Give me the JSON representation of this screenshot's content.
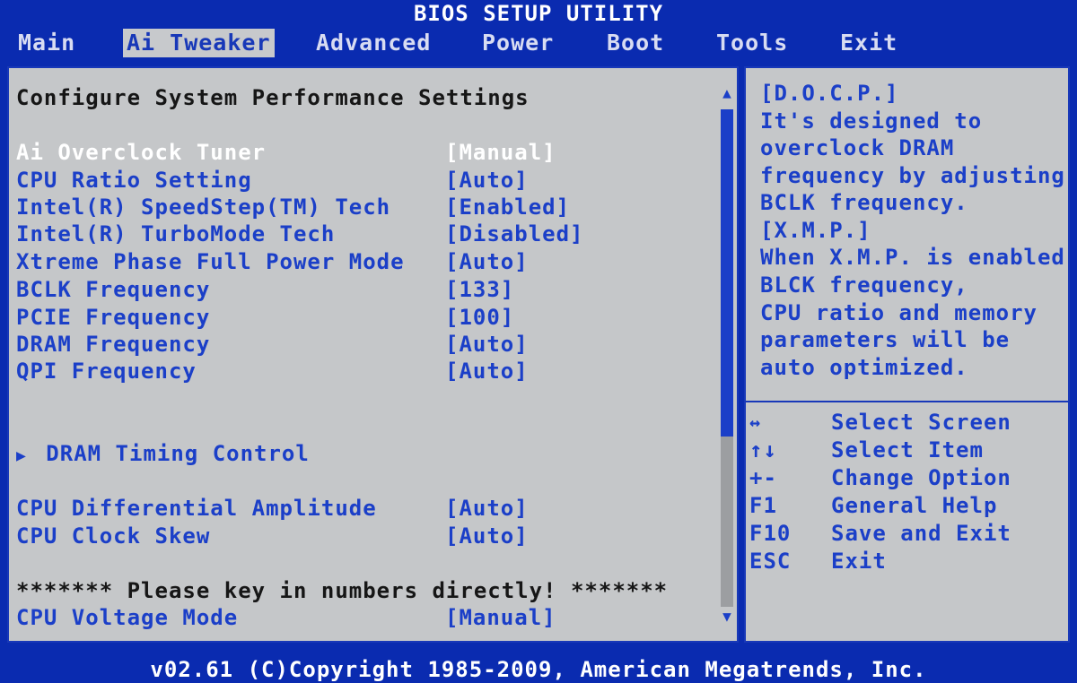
{
  "title": "BIOS SETUP UTILITY",
  "menu": {
    "main": "Main",
    "ai_tweaker": "Ai Tweaker",
    "advanced": "Advanced",
    "power": "Power",
    "boot": "Boot",
    "tools": "Tools",
    "exit": "Exit"
  },
  "section_title": "Configure System Performance Settings",
  "settings": [
    {
      "label": "Ai Overclock Tuner",
      "value": "[Manual]"
    },
    {
      "label": "CPU Ratio Setting",
      "value": "[Auto]"
    },
    {
      "label": "Intel(R) SpeedStep(TM) Tech",
      "value": "[Enabled]"
    },
    {
      "label": "Intel(R) TurboMode Tech",
      "value": "[Disabled]"
    },
    {
      "label": "Xtreme Phase Full Power Mode",
      "value": "[Auto]"
    },
    {
      "label": "BCLK Frequency",
      "value": "[133]"
    },
    {
      "label": "PCIE Frequency",
      "value": "[100]"
    },
    {
      "label": "DRAM Frequency",
      "value": "[Auto]"
    },
    {
      "label": "QPI Frequency",
      "value": "[Auto]"
    }
  ],
  "submenu": {
    "arrow": "▶",
    "label": "DRAM Timing Control"
  },
  "settings2": [
    {
      "label": "CPU Differential Amplitude",
      "value": "[Auto]"
    },
    {
      "label": "CPU Clock Skew",
      "value": "[Auto]"
    }
  ],
  "notice": "******* Please key in numbers directly! *******",
  "voltage": {
    "label": "CPU Voltage Mode",
    "value": "[Manual]"
  },
  "help_text": [
    "[D.O.C.P.]",
    "It's designed to",
    "overclock DRAM",
    "frequency by adjusting",
    "BCLK frequency.",
    "[X.M.P.]",
    "When X.M.P. is enabled",
    "BLCK frequency,",
    "CPU ratio and memory",
    "parameters will be",
    "auto optimized."
  ],
  "keys": [
    {
      "key": "↔",
      "desc": "Select Screen"
    },
    {
      "key": "↑↓",
      "desc": "Select Item"
    },
    {
      "key": "+-",
      "desc": "Change Option"
    },
    {
      "key": "F1",
      "desc": "General Help"
    },
    {
      "key": "F10",
      "desc": "Save and Exit"
    },
    {
      "key": "ESC",
      "desc": "Exit"
    }
  ],
  "footer": "v02.61 (C)Copyright 1985-2009, American Megatrends, Inc.",
  "colors": {
    "background": "#0a2bb0",
    "panel": "#c5c7c9",
    "item_text": "#1b3fc8",
    "highlight": "#ffffff"
  }
}
